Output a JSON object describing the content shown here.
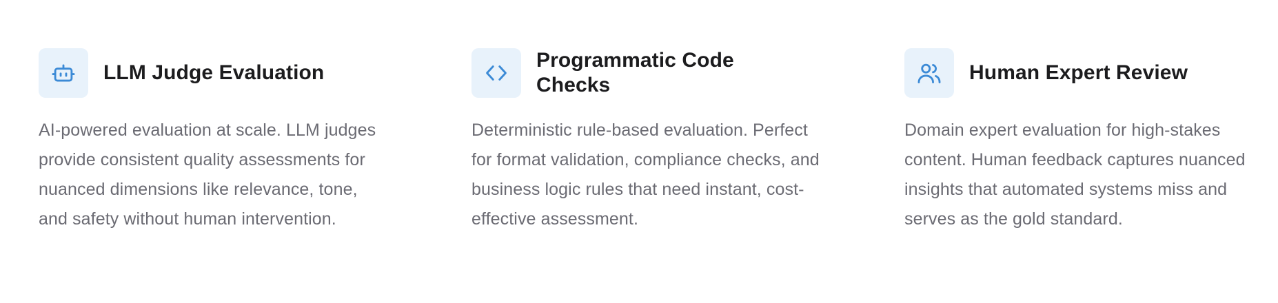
{
  "colors": {
    "icon_accent": "#3b8ad6",
    "icon_background": "#e8f2fb",
    "title_text": "#1c1c1e",
    "body_text": "#6b6b73"
  },
  "features": [
    {
      "icon": "robot-icon",
      "title": "LLM Judge Evaluation",
      "description": "AI-powered evaluation at scale. LLM judges provide consistent quality assessments for nuanced dimensions like relevance, tone, and safety without human intervention."
    },
    {
      "icon": "code-icon",
      "title": "Programmatic Code Checks",
      "description": "Deterministic rule-based evaluation. Perfect for format validation, compliance checks, and business logic rules that need instant, cost-effective assessment."
    },
    {
      "icon": "users-icon",
      "title": "Human Expert Review",
      "description": "Domain expert evaluation for high-stakes content. Human feedback captures nuanced insights that automated systems miss and serves as the gold standard."
    }
  ]
}
